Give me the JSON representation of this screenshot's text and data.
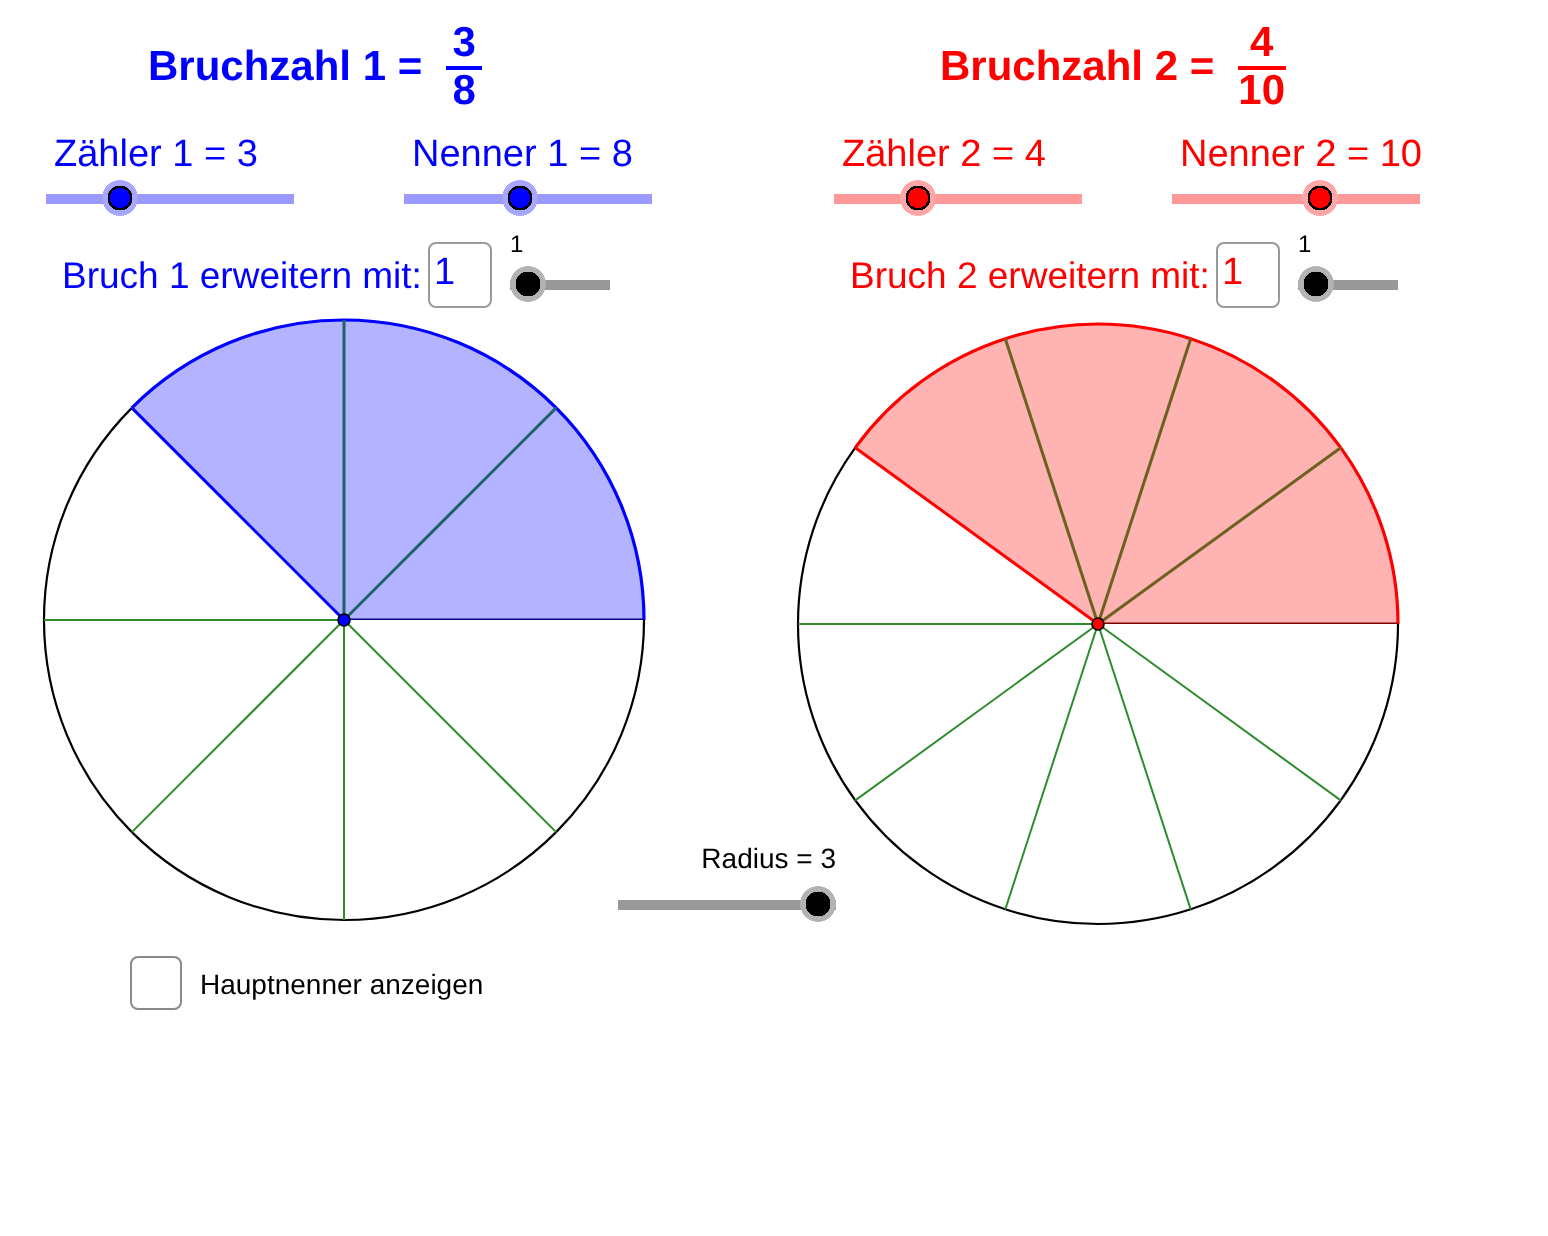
{
  "fractions": [
    {
      "color": "#0000ff",
      "title": {
        "text": "Bruchzahl 1 =",
        "numerator": "3",
        "denominator": "8"
      },
      "sliders": [
        {
          "label": "Zähler 1 = 3",
          "level": 0.26
        },
        {
          "label": "Nenner 1 = 8",
          "level": 0.46
        }
      ],
      "extend": {
        "label": "Bruch 1 erweitern mit:",
        "value": "1",
        "slider_value": "1",
        "level": 0
      }
    },
    {
      "color": "#ff0000",
      "title": {
        "text": "Bruchzahl 2 =",
        "numerator": "4",
        "denominator": "10"
      },
      "sliders": [
        {
          "label": "Zähler 2 = 4",
          "level": 0.31
        },
        {
          "label": "Nenner 2 = 10",
          "level": 0.61
        }
      ],
      "extend": {
        "label": "Bruch 2 erweitern mit:",
        "value": "1",
        "slider_value": "1",
        "level": 0
      }
    }
  ],
  "radius_slider": {
    "label": "Radius = 3",
    "level": 1
  },
  "checkbox": {
    "label": "Hauptnenner anzeigen",
    "checked": false
  }
}
